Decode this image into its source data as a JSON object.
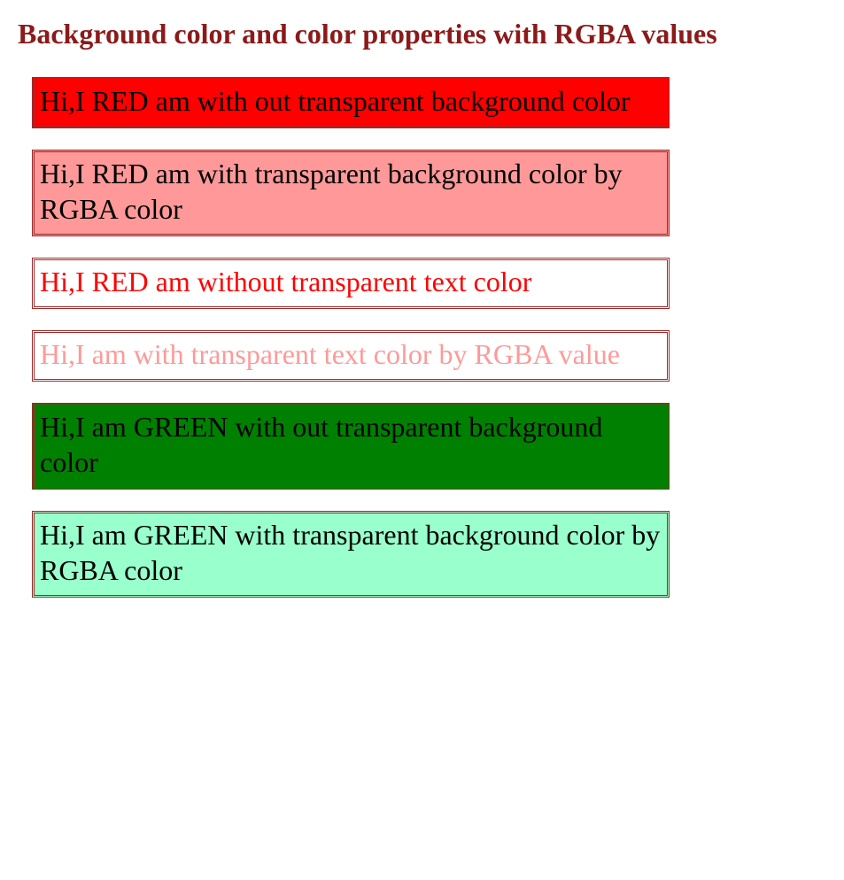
{
  "heading": "Background color and color properties with RGBA values",
  "boxes": [
    {
      "text": "Hi,I RED am with out transparent background color"
    },
    {
      "text": "Hi,I RED am with transparent background color by RGBA color"
    },
    {
      "text": "Hi,I RED am without transparent text color"
    },
    {
      "text": "Hi,I am with transparent text color by RGBA value"
    },
    {
      "text": "Hi,I am GREEN with out transparent background color"
    },
    {
      "text": "Hi,I am GREEN with transparent background color by RGBA color"
    }
  ]
}
